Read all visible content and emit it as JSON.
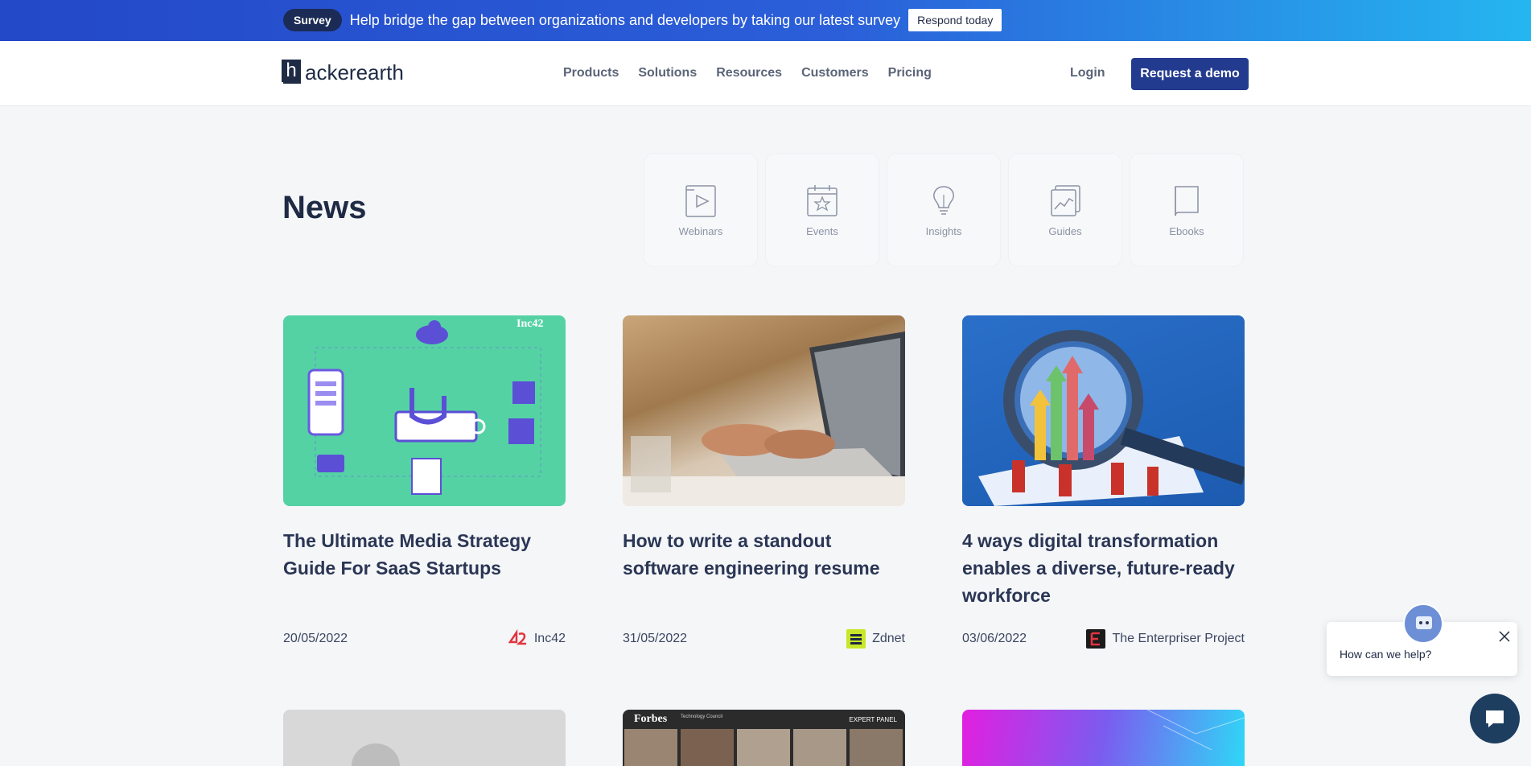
{
  "banner": {
    "pill": "Survey",
    "text": "Help bridge the gap between organizations and developers by taking our latest survey",
    "cta": "Respond today"
  },
  "nav": {
    "logo_letter": "h",
    "logo_text": "ackerearth",
    "links": [
      "Products",
      "Solutions",
      "Resources",
      "Customers",
      "Pricing"
    ],
    "login": "Login",
    "demo": "Request a demo"
  },
  "page": {
    "title": "News",
    "resources": [
      {
        "label": "Webinars",
        "icon": "play-icon"
      },
      {
        "label": "Events",
        "icon": "calendar-star-icon"
      },
      {
        "label": "Insights",
        "icon": "lightbulb-icon"
      },
      {
        "label": "Guides",
        "icon": "chart-doc-icon"
      },
      {
        "label": "Ebooks",
        "icon": "book-icon"
      }
    ]
  },
  "articles": [
    {
      "title": "The Ultimate Media Strategy Guide For SaaS Startups",
      "date": "20/05/2022",
      "source": "Inc42",
      "image_badge": "Inc42"
    },
    {
      "title": "How to write a standout software engineering resume",
      "date": "31/05/2022",
      "source": "Zdnet"
    },
    {
      "title": "4 ways digital transformation enables a diverse, future-ready workforce",
      "date": "03/06/2022",
      "source": "The Enterpriser Project"
    }
  ],
  "bottom_cards": {
    "forbes_label": "Forbes",
    "forbes_sub": "Technology Council",
    "forbes_tag": "EXPERT PANEL"
  },
  "chat": {
    "prompt": "How can we help?"
  },
  "colors": {
    "accent": "#233b8f",
    "banner_start": "#2348c8",
    "banner_end": "#25b6f0",
    "text": "#1f2a44"
  }
}
